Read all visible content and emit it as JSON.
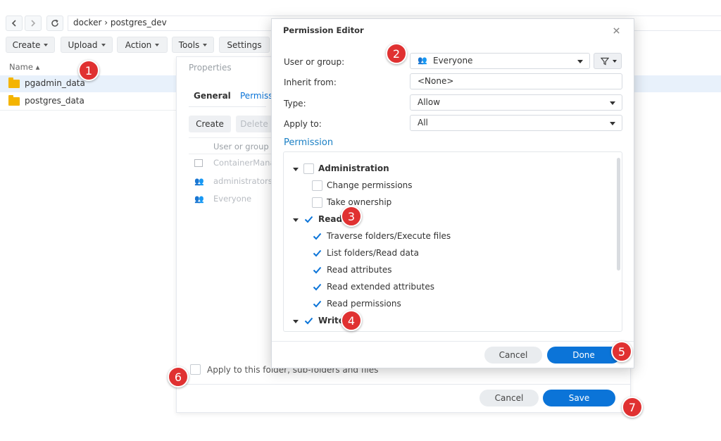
{
  "breadcrumb": {
    "path": "docker › postgres_dev"
  },
  "toolbar": {
    "create": "Create",
    "upload": "Upload",
    "action": "Action",
    "tools": "Tools",
    "settings": "Settings"
  },
  "file_list": {
    "header": "Name ▴",
    "rows": [
      {
        "name": "pgadmin_data",
        "selected": true
      },
      {
        "name": "postgres_data",
        "selected": false
      }
    ]
  },
  "properties": {
    "title": "Properties",
    "tabs": [
      "General",
      "Permiss"
    ],
    "create_btn": "Create",
    "delete_btn": "Delete",
    "column": "User or group",
    "entries": [
      "ContainerMana",
      "administrators",
      "Everyone"
    ],
    "apply_label": "Apply to this folder, sub-folders and files",
    "cancel": "Cancel",
    "save": "Save"
  },
  "editor": {
    "title": "Permission Editor",
    "user_label": "User or group:",
    "user_value": "Everyone",
    "inherit_label": "Inherit from:",
    "inherit_value": "<None>",
    "type_label": "Type:",
    "type_value": "Allow",
    "apply_label": "Apply to:",
    "apply_value": "All",
    "section": "Permission",
    "groups": {
      "admin": {
        "label": "Administration",
        "checked": false,
        "items": [
          {
            "label": "Change permissions",
            "checked": false
          },
          {
            "label": "Take ownership",
            "checked": false
          }
        ]
      },
      "read": {
        "label": "Read",
        "checked": true,
        "items": [
          {
            "label": "Traverse folders/Execute files",
            "checked": true
          },
          {
            "label": "List folders/Read data",
            "checked": true
          },
          {
            "label": "Read attributes",
            "checked": true
          },
          {
            "label": "Read extended attributes",
            "checked": true
          },
          {
            "label": "Read permissions",
            "checked": true
          }
        ]
      },
      "write": {
        "label": "Write",
        "checked": true
      }
    },
    "cancel": "Cancel",
    "done": "Done"
  },
  "badges": [
    "1",
    "2",
    "3",
    "4",
    "5",
    "6",
    "7"
  ],
  "colors": {
    "accent": "#0b74d8",
    "badge": "#e03131",
    "folder": "#f4b400",
    "selection": "#e8f1fb"
  }
}
